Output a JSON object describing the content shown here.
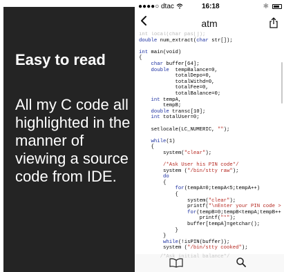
{
  "promo": {
    "tagline": "Easy to read",
    "description": "All my C code all highlighted in the manner of viewing a source code from IDE."
  },
  "status_bar": {
    "carrier": "●●●●○ dtac",
    "wifi_icon": "wifi-icon",
    "time": "16:18",
    "bluetooth_icon": "bluetooth-icon",
    "battery_icon": "battery-icon"
  },
  "nav": {
    "back_icon": "chevron-left-icon",
    "back_glyph": "<",
    "title": "atm",
    "share_icon": "share-icon"
  },
  "toolbar": {
    "book_icon": "book-icon",
    "search_icon": "search-icon",
    "ghost_text": "       /*Ask initial balance*/"
  },
  "code": [
    {
      "text": "int local(char pas[]);",
      "ghost": true
    },
    {
      "text": "double num_extract(char str[]);"
    },
    {
      "text": ""
    },
    {
      "text": "int main(void)"
    },
    {
      "text": "{"
    },
    {
      "text": "    char buffer[64];"
    },
    {
      "text": "    double  tempBalance=0,"
    },
    {
      "text": "            totalDepo=0,"
    },
    {
      "text": "            totalWithd=0,"
    },
    {
      "text": "            totalFee=0,"
    },
    {
      "text": "            totalBalance=0;"
    },
    {
      "text": "    int tempA,"
    },
    {
      "text": "        tempB;"
    },
    {
      "text": "    double transc[10];"
    },
    {
      "text": "    int totalUser=0;"
    },
    {
      "text": ""
    },
    {
      "text": "    setlocale(LC_NUMERIC, \"\");"
    },
    {
      "text": ""
    },
    {
      "text": "    while(1)"
    },
    {
      "text": "    {"
    },
    {
      "text": "        system(\"clear\");"
    },
    {
      "text": ""
    },
    {
      "text": "        /*Ask User his PIN code*/"
    },
    {
      "text": "        system (\"/bin/stty raw\");"
    },
    {
      "text": "        do"
    },
    {
      "text": "        {"
    },
    {
      "text": "            for(tempA=0;tempA<5;tempA++)"
    },
    {
      "text": "            {"
    },
    {
      "text": "                system(\"clear\");"
    },
    {
      "text": "                printf(\"\\nEnter your PIN code >"
    },
    {
      "text": "                for(tempB=0;tempB<tempA;tempB++"
    },
    {
      "text": "                    printf(\"*\");"
    },
    {
      "text": "                buffer[tempA]=getchar();"
    },
    {
      "text": "            }"
    },
    {
      "text": "        }"
    },
    {
      "text": "        while(!isPIN(buffer));"
    },
    {
      "text": "        system (\"/bin/stty cooked\");"
    },
    {
      "text": "        totalUser++;"
    },
    {
      "text": "        if(num_extract(buffer)==0)"
    },
    {
      "text": "        {"
    },
    {
      "text": "            system(\"clear\");"
    },
    {
      "text": "            break;"
    }
  ]
}
